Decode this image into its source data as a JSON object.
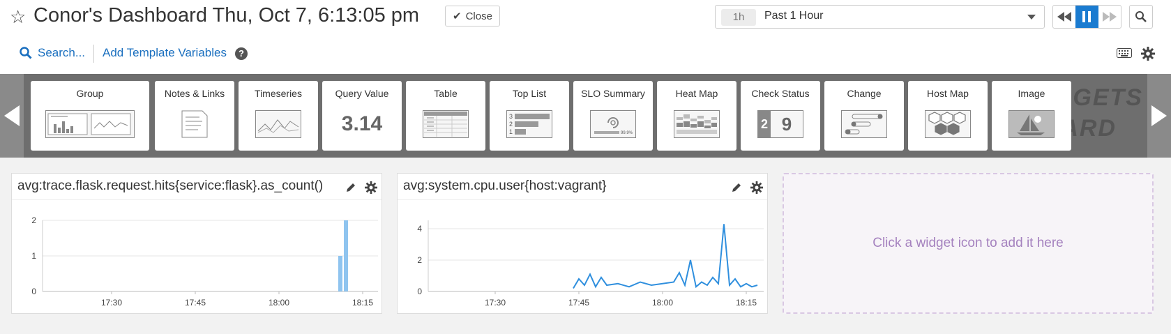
{
  "header": {
    "title": "Conor's Dashboard Thu, Oct 7, 6:13:05 pm",
    "close_label": "Close",
    "timeframe_short": "1h",
    "timeframe_label": "Past 1 Hour"
  },
  "toolbar": {
    "search_label": "Search...",
    "template_vars_label": "Add Template Variables"
  },
  "tray": {
    "background_text_line1": "WIDGETS",
    "background_text_line2": "BOARD",
    "tiles": [
      {
        "label": "Group"
      },
      {
        "label": "Notes & Links"
      },
      {
        "label": "Timeseries"
      },
      {
        "label": "Query Value",
        "sample": "3.14"
      },
      {
        "label": "Table"
      },
      {
        "label": "Top List",
        "sample_ranks": [
          "3",
          "2",
          "1"
        ]
      },
      {
        "label": "SLO Summary",
        "sample": "99.9%"
      },
      {
        "label": "Heat Map"
      },
      {
        "label": "Check Status",
        "sample_a": "2",
        "sample_b": "9"
      },
      {
        "label": "Change"
      },
      {
        "label": "Host Map"
      },
      {
        "label": "Image"
      }
    ]
  },
  "panels": [
    {
      "title": "avg:trace.flask.request.hits{service:flask}.as_count()",
      "y_ticks": [
        "2",
        "1",
        "0"
      ],
      "x_ticks": [
        "17:30",
        "17:45",
        "18:00",
        "18:15"
      ]
    },
    {
      "title": "avg:system.cpu.user{host:vagrant}",
      "y_ticks": [
        "4",
        "2",
        "0"
      ],
      "x_ticks": [
        "17:30",
        "17:45",
        "18:00",
        "18:15"
      ]
    }
  ],
  "drop_zone_label": "Click a widget icon to add it here",
  "chart_data": [
    {
      "type": "bar",
      "x": [
        "18:11",
        "18:12"
      ],
      "values": [
        1,
        2
      ],
      "ylim": [
        0,
        2
      ],
      "color": "#8fc4ef"
    },
    {
      "type": "line",
      "x": [
        "17:44",
        "17:45",
        "17:46",
        "17:47",
        "17:48",
        "17:49",
        "17:50",
        "17:52",
        "17:54",
        "17:56",
        "17:58",
        "18:00",
        "18:02",
        "18:03",
        "18:04",
        "18:05",
        "18:06",
        "18:07",
        "18:08",
        "18:09",
        "18:10",
        "18:11",
        "18:12",
        "18:13",
        "18:14",
        "18:15",
        "18:16",
        "18:17"
      ],
      "values": [
        0.2,
        0.8,
        0.4,
        1.1,
        0.3,
        0.9,
        0.4,
        0.5,
        0.3,
        0.6,
        0.4,
        0.5,
        0.6,
        1.2,
        0.4,
        2.0,
        0.3,
        0.6,
        0.4,
        0.9,
        0.5,
        4.3,
        0.4,
        0.8,
        0.3,
        0.5,
        0.3,
        0.4
      ],
      "ylim": [
        0,
        4.5
      ],
      "color": "#2f8fde"
    }
  ]
}
